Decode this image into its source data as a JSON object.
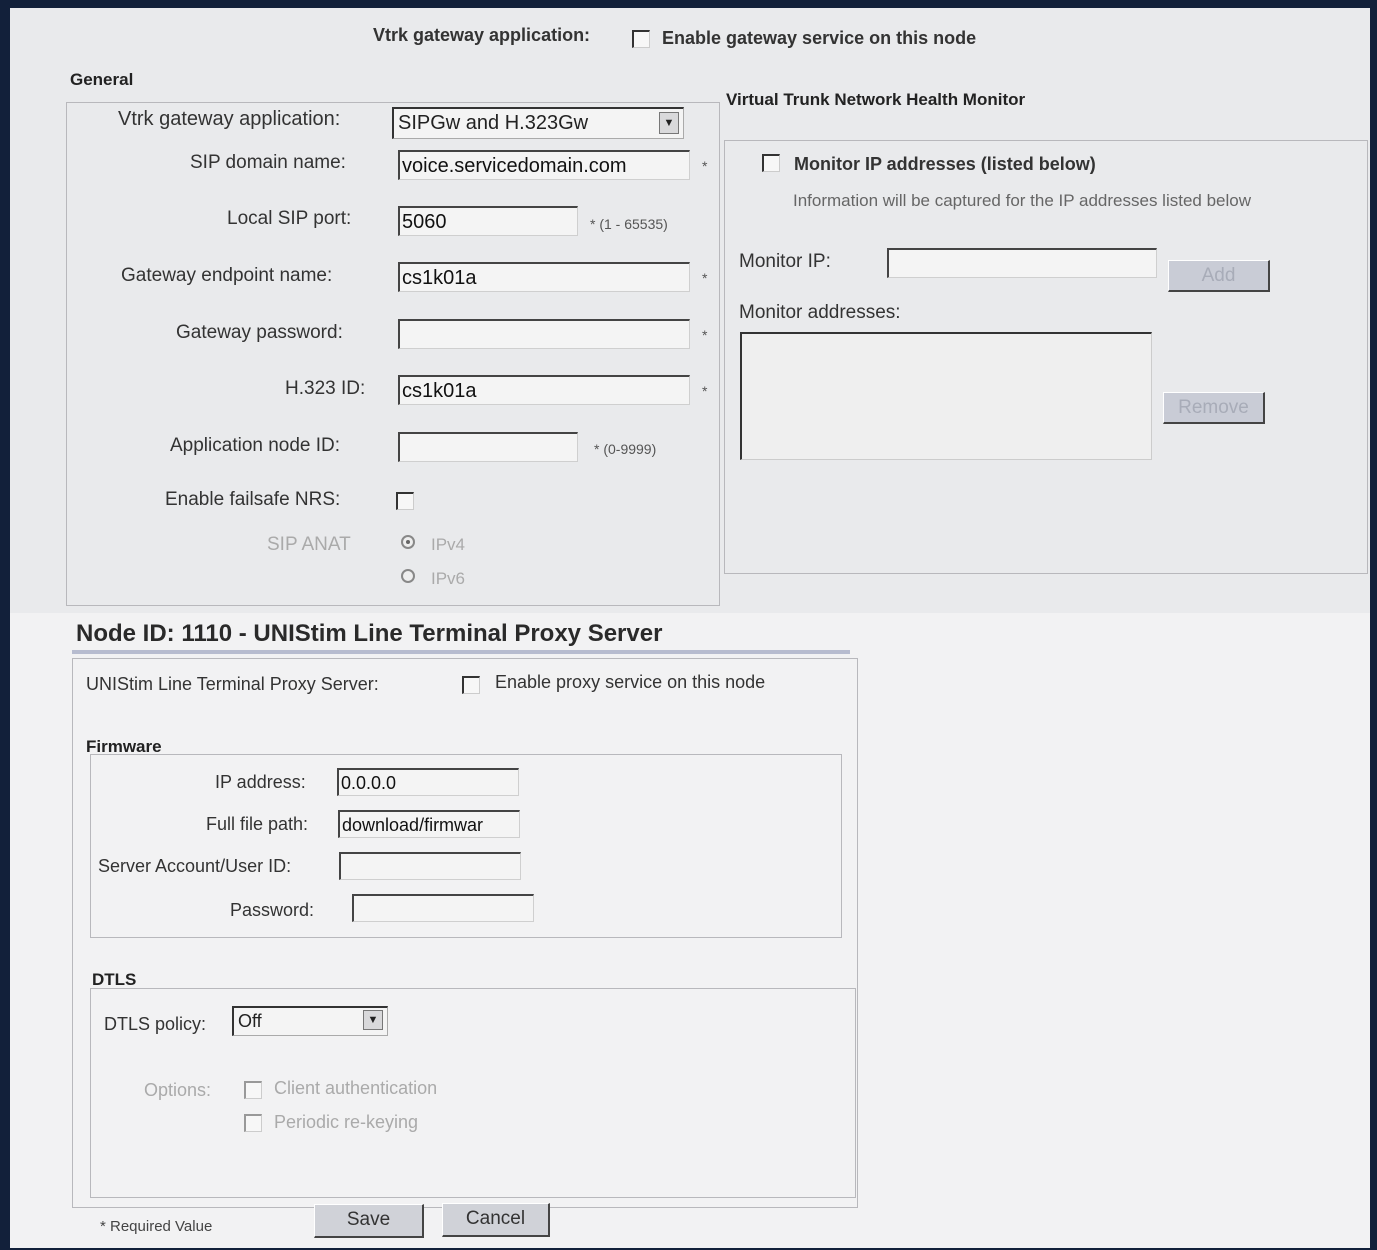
{
  "top": {
    "vtrk_app_label": "Vtrk gateway application:",
    "enable_gateway_label": "Enable gateway service on this node"
  },
  "general": {
    "title": "General",
    "vtrk_app_label": "Vtrk gateway application:",
    "vtrk_app_value": "SIPGw and H.323Gw",
    "sip_domain_label": "SIP domain name:",
    "sip_domain_value": "voice.servicedomain.com",
    "local_sip_port_label": "Local SIP port:",
    "local_sip_port_value": "5060",
    "local_sip_port_hint": "* (1 - 65535)",
    "gateway_endpoint_label": "Gateway endpoint name:",
    "gateway_endpoint_value": "cs1k01a",
    "gateway_password_label": "Gateway password:",
    "gateway_password_value": "",
    "h323_id_label": "H.323 ID:",
    "h323_id_value": "cs1k01a",
    "app_node_id_label": "Application node ID:",
    "app_node_id_value": "",
    "app_node_id_hint": "* (0-9999)",
    "failsafe_label": "Enable failsafe NRS:",
    "sip_anat_label": "SIP ANAT",
    "ipv4_label": "IPv4",
    "ipv6_label": "IPv6",
    "required_star": "*"
  },
  "monitor": {
    "title": "Virtual Trunk Network Health Monitor",
    "monitor_ip_check_label": "Monitor IP addresses (listed below)",
    "info": "Information will be captured for the IP addresses listed below",
    "monitor_ip_label": "Monitor IP:",
    "monitor_ip_value": "",
    "add_label": "Add",
    "addresses_label": "Monitor addresses:",
    "remove_label": "Remove"
  },
  "proxy": {
    "title": "Node ID: 1110 - UNIStim Line Terminal Proxy Server",
    "server_label": "UNIStim Line Terminal Proxy Server:",
    "enable_label": "Enable proxy service on this node",
    "firmware_title": "Firmware",
    "ip_label": "IP address:",
    "ip_value": "0.0.0.0",
    "path_label": "Full file path:",
    "path_value": "download/firmwar",
    "account_label": "Server Account/User ID:",
    "account_value": "",
    "password_label": "Password:",
    "password_value": "",
    "dtls_title": "DTLS",
    "dtls_policy_label": "DTLS policy:",
    "dtls_policy_value": "Off",
    "options_label": "Options:",
    "client_auth_label": "Client authentication",
    "rekey_label": "Periodic re-keying"
  },
  "footer": {
    "required_note": "* Required Value",
    "save_label": "Save",
    "cancel_label": "Cancel"
  },
  "icons": {
    "dropdown": "chevron-down-icon"
  }
}
